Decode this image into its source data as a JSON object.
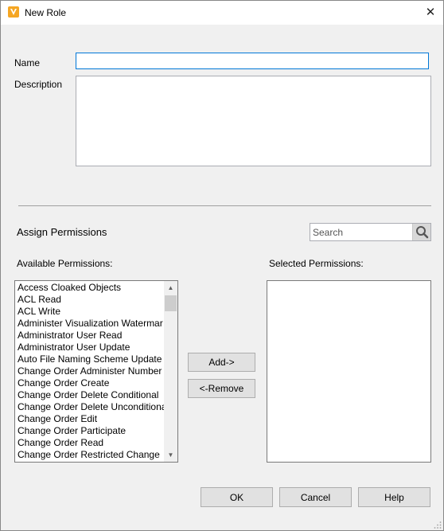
{
  "window": {
    "title": "New Role",
    "app_icon": "autodesk-vault-logo",
    "close_glyph": "✕"
  },
  "form": {
    "name_label": "Name",
    "name_value": "",
    "description_label": "Description",
    "description_value": ""
  },
  "permissions": {
    "section_title": "Assign Permissions",
    "search_placeholder": "Search",
    "search_icon": "magnifier-icon",
    "available_label": "Available Permissions:",
    "selected_label": "Selected Permissions:",
    "available_items": [
      "Access Cloaked Objects",
      "ACL Read",
      "ACL Write",
      "Administer Visualization Watermar",
      "Administrator User Read",
      "Administrator User Update",
      "Auto File Naming Scheme Update",
      "Change Order Administer Number",
      "Change Order Create",
      "Change Order Delete Conditional",
      "Change Order Delete Unconditiona",
      "Change Order Edit",
      "Change Order Participate",
      "Change Order Read",
      "Change Order Restricted Change"
    ],
    "selected_items": [],
    "add_label": "Add->",
    "remove_label": "<-Remove"
  },
  "footer": {
    "ok_label": "OK",
    "cancel_label": "Cancel",
    "help_label": "Help"
  },
  "colors": {
    "accent": "#0078d7",
    "dialog_bg": "#f0f0f0",
    "icon_orange": "#f5a623"
  }
}
